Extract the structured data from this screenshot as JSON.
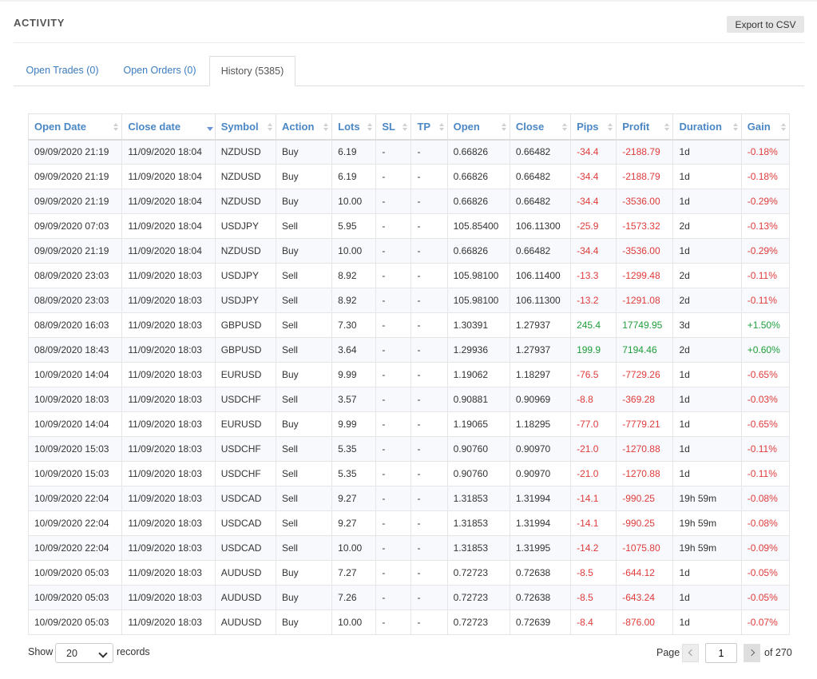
{
  "header": {
    "title": "ACTIVITY",
    "export_label": "Export to CSV"
  },
  "tabs": [
    {
      "label": "Open Trades (0)",
      "active": false
    },
    {
      "label": "Open Orders (0)",
      "active": false
    },
    {
      "label": "History (5385)",
      "active": true
    }
  ],
  "table": {
    "columns": [
      "Open Date",
      "Close date",
      "Symbol",
      "Action",
      "Lots",
      "SL",
      "TP",
      "Open",
      "Close",
      "Pips",
      "Profit",
      "Duration",
      "Gain"
    ],
    "sorted_column": "Close date",
    "rows": [
      [
        "09/09/2020 21:19",
        "11/09/2020 18:04",
        "NZDUSD",
        "Buy",
        "6.19",
        "-",
        "-",
        "0.66826",
        "0.66482",
        "-34.4",
        "-2188.79",
        "1d",
        "-0.18%"
      ],
      [
        "09/09/2020 21:19",
        "11/09/2020 18:04",
        "NZDUSD",
        "Buy",
        "6.19",
        "-",
        "-",
        "0.66826",
        "0.66482",
        "-34.4",
        "-2188.79",
        "1d",
        "-0.18%"
      ],
      [
        "09/09/2020 21:19",
        "11/09/2020 18:04",
        "NZDUSD",
        "Buy",
        "10.00",
        "-",
        "-",
        "0.66826",
        "0.66482",
        "-34.4",
        "-3536.00",
        "1d",
        "-0.29%"
      ],
      [
        "09/09/2020 07:03",
        "11/09/2020 18:04",
        "USDJPY",
        "Sell",
        "5.95",
        "-",
        "-",
        "105.85400",
        "106.11300",
        "-25.9",
        "-1573.32",
        "2d",
        "-0.13%"
      ],
      [
        "09/09/2020 21:19",
        "11/09/2020 18:04",
        "NZDUSD",
        "Buy",
        "10.00",
        "-",
        "-",
        "0.66826",
        "0.66482",
        "-34.4",
        "-3536.00",
        "1d",
        "-0.29%"
      ],
      [
        "08/09/2020 23:03",
        "11/09/2020 18:03",
        "USDJPY",
        "Sell",
        "8.92",
        "-",
        "-",
        "105.98100",
        "106.11400",
        "-13.3",
        "-1299.48",
        "2d",
        "-0.11%"
      ],
      [
        "08/09/2020 23:03",
        "11/09/2020 18:03",
        "USDJPY",
        "Sell",
        "8.92",
        "-",
        "-",
        "105.98100",
        "106.11300",
        "-13.2",
        "-1291.08",
        "2d",
        "-0.11%"
      ],
      [
        "08/09/2020 16:03",
        "11/09/2020 18:03",
        "GBPUSD",
        "Sell",
        "7.30",
        "-",
        "-",
        "1.30391",
        "1.27937",
        "245.4",
        "17749.95",
        "3d",
        "+1.50%"
      ],
      [
        "08/09/2020 18:43",
        "11/09/2020 18:03",
        "GBPUSD",
        "Sell",
        "3.64",
        "-",
        "-",
        "1.29936",
        "1.27937",
        "199.9",
        "7194.46",
        "2d",
        "+0.60%"
      ],
      [
        "10/09/2020 14:04",
        "11/09/2020 18:03",
        "EURUSD",
        "Buy",
        "9.99",
        "-",
        "-",
        "1.19062",
        "1.18297",
        "-76.5",
        "-7729.26",
        "1d",
        "-0.65%"
      ],
      [
        "10/09/2020 18:03",
        "11/09/2020 18:03",
        "USDCHF",
        "Sell",
        "3.57",
        "-",
        "-",
        "0.90881",
        "0.90969",
        "-8.8",
        "-369.28",
        "1d",
        "-0.03%"
      ],
      [
        "10/09/2020 14:04",
        "11/09/2020 18:03",
        "EURUSD",
        "Buy",
        "9.99",
        "-",
        "-",
        "1.19065",
        "1.18295",
        "-77.0",
        "-7779.21",
        "1d",
        "-0.65%"
      ],
      [
        "10/09/2020 15:03",
        "11/09/2020 18:03",
        "USDCHF",
        "Sell",
        "5.35",
        "-",
        "-",
        "0.90760",
        "0.90970",
        "-21.0",
        "-1270.88",
        "1d",
        "-0.11%"
      ],
      [
        "10/09/2020 15:03",
        "11/09/2020 18:03",
        "USDCHF",
        "Sell",
        "5.35",
        "-",
        "-",
        "0.90760",
        "0.90970",
        "-21.0",
        "-1270.88",
        "1d",
        "-0.11%"
      ],
      [
        "10/09/2020 22:04",
        "11/09/2020 18:03",
        "USDCAD",
        "Sell",
        "9.27",
        "-",
        "-",
        "1.31853",
        "1.31994",
        "-14.1",
        "-990.25",
        "19h 59m",
        "-0.08%"
      ],
      [
        "10/09/2020 22:04",
        "11/09/2020 18:03",
        "USDCAD",
        "Sell",
        "9.27",
        "-",
        "-",
        "1.31853",
        "1.31994",
        "-14.1",
        "-990.25",
        "19h 59m",
        "-0.08%"
      ],
      [
        "10/09/2020 22:04",
        "11/09/2020 18:03",
        "USDCAD",
        "Sell",
        "10.00",
        "-",
        "-",
        "1.31853",
        "1.31995",
        "-14.2",
        "-1075.80",
        "19h 59m",
        "-0.09%"
      ],
      [
        "10/09/2020 05:03",
        "11/09/2020 18:03",
        "AUDUSD",
        "Buy",
        "7.27",
        "-",
        "-",
        "0.72723",
        "0.72638",
        "-8.5",
        "-644.12",
        "1d",
        "-0.05%"
      ],
      [
        "10/09/2020 05:03",
        "11/09/2020 18:03",
        "AUDUSD",
        "Buy",
        "7.26",
        "-",
        "-",
        "0.72723",
        "0.72638",
        "-8.5",
        "-643.24",
        "1d",
        "-0.05%"
      ],
      [
        "10/09/2020 05:03",
        "11/09/2020 18:03",
        "AUDUSD",
        "Buy",
        "10.00",
        "-",
        "-",
        "0.72723",
        "0.72639",
        "-8.4",
        "-876.00",
        "1d",
        "-0.07%"
      ]
    ]
  },
  "footer": {
    "show_label": "Show",
    "records_value": "20",
    "records_label": "records",
    "page_label": "Page",
    "page_value": "1",
    "of_label": "of 270"
  },
  "colors": {
    "link": "#3b7bbf",
    "negative": "#e03b3b",
    "positive": "#1e9e3a"
  }
}
